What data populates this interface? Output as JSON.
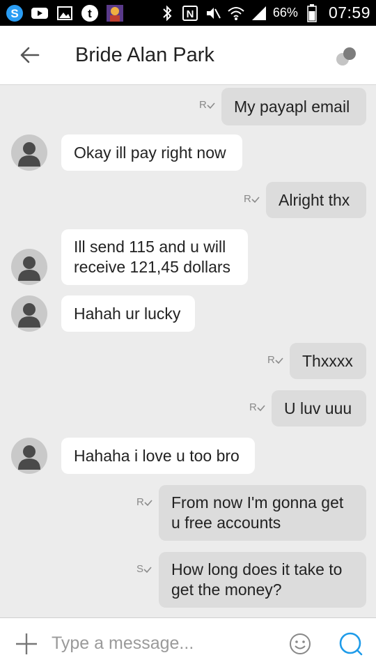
{
  "statusbar": {
    "icons": [
      "skype-icon",
      "youtube-icon",
      "gallery-icon",
      "tumblr-icon",
      "app-avatar-icon",
      "bluetooth-icon",
      "nfc-icon",
      "mute-icon",
      "wifi-icon",
      "signal-icon",
      "battery-icon"
    ],
    "battery": "66%",
    "time": "07:59"
  },
  "header": {
    "title": "Bride Alan Park"
  },
  "messages": [
    {
      "side": "out",
      "text": "My payapl email",
      "mark": "R"
    },
    {
      "side": "in",
      "text": "Okay ill pay right now"
    },
    {
      "side": "out",
      "text": "Alright thx",
      "mark": "R"
    },
    {
      "side": "in",
      "text": "Ill send 115 and u will\nreceive 121,45 dollars"
    },
    {
      "side": "in",
      "text": "Hahah ur lucky"
    },
    {
      "side": "out",
      "text": "Thxxxx",
      "mark": "R"
    },
    {
      "side": "out",
      "text": "U luv uuu",
      "mark": "R"
    },
    {
      "side": "in",
      "text": "Hahaha i love u too bro"
    },
    {
      "side": "out",
      "text": "From now I'm gonna get\nu free accounts",
      "mark": "R"
    },
    {
      "side": "out",
      "text": "How long does it take to\nget the money?",
      "mark": "S"
    }
  ],
  "input": {
    "placeholder": "Type a message..."
  },
  "colors": {
    "statusbar": "#000000",
    "header": "#ffffff",
    "chat_bg": "#ececec",
    "incoming_bubble": "#ffffff",
    "outgoing_bubble": "#dcdcdc",
    "accent": "#1e9be9"
  }
}
